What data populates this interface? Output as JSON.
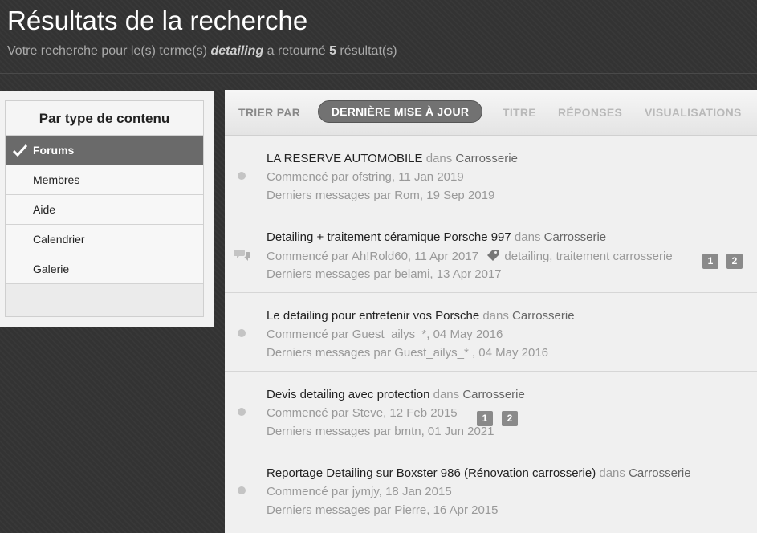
{
  "header": {
    "title": "Résultats de la recherche",
    "subtitle_prefix": "Votre recherche pour le(s) terme(s)",
    "search_term": "detailing",
    "subtitle_middle": "a retourné",
    "result_count": "5",
    "subtitle_suffix": "résultat(s)"
  },
  "filter": {
    "heading": "Par type de contenu",
    "items": [
      {
        "label": "Forums",
        "active": true
      },
      {
        "label": "Membres"
      },
      {
        "label": "Aide"
      },
      {
        "label": "Calendrier"
      },
      {
        "label": "Galerie"
      }
    ]
  },
  "sort": {
    "label": "TRIER PAR",
    "active": "DERNIÈRE MISE À JOUR",
    "options": [
      "TITRE",
      "RÉPONSES",
      "VISUALISATIONS"
    ]
  },
  "results": [
    {
      "title": "LA RESERVE AUTOMOBILE",
      "in_word": "dans",
      "forum": "Carrosserie",
      "started": "Commencé par ofstring, 11 Jan 2019",
      "last": "Derniers messages par Rom, 19 Sep 2019",
      "icon": "status-dot"
    },
    {
      "title": "Detailing + traitement céramique Porsche 997",
      "in_word": "dans",
      "forum": "Carrosserie",
      "started": "Commencé par Ah!Rold60, 11 Apr 2017",
      "tags": "detailing, traitement carrosserie",
      "last": "Derniers messages par belami, 13 Apr 2017",
      "pages": [
        "1",
        "2"
      ],
      "icon": "chat-bubbles-icon"
    },
    {
      "title": "Le detailing pour entretenir vos Porsche",
      "in_word": "dans",
      "forum": "Carrosserie",
      "started": "Commencé par Guest_ailys_*, 04 May 2016",
      "last": "Derniers messages par Guest_ailys_* , 04 May 2016",
      "icon": "status-dot"
    },
    {
      "title": "Devis detailing avec protection",
      "in_word": "dans",
      "forum": "Carrosserie",
      "started": "Commencé par Steve, 12 Feb 2015",
      "last": "Derniers messages par bmtn, 01 Jun 2021",
      "pages": [
        "1",
        "2"
      ],
      "icon": "status-dot"
    },
    {
      "title": "Reportage Detailing sur Boxster 986 (Rénovation carrosserie)",
      "in_word": "dans",
      "forum": "Carrosserie",
      "started": "Commencé par jymjy, 18 Jan 2015",
      "last": "Derniers messages par Pierre, 16 Apr 2015",
      "icon": "status-dot"
    }
  ]
}
